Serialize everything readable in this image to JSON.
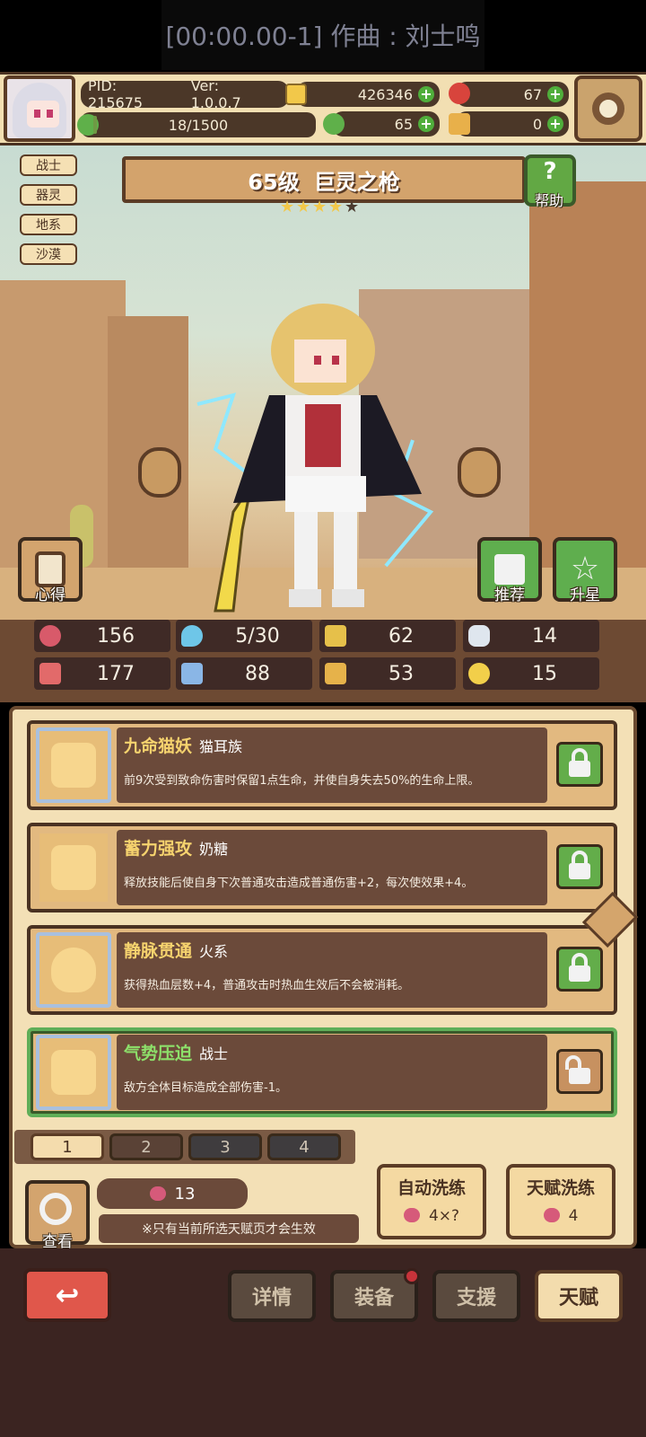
{
  "caption": "[00:00.00-1] 作曲 : 刘士鸣",
  "header": {
    "pid": "PID: 215675",
    "version": "Ver: 1.0.0.7",
    "gold": "426346",
    "ruby": "67",
    "clover": "65",
    "key": "0",
    "stamina": "18/1500",
    "stamina_fraction": 0.012
  },
  "tags": [
    "战士",
    "器灵",
    "地系",
    "沙漠"
  ],
  "hero": {
    "level": "65级",
    "name": "巨灵之枪",
    "stars_filled": 4,
    "stars_total": 5
  },
  "buttons": {
    "help": "帮助",
    "help_icon": "?",
    "insight": "心得",
    "recommend": "推荐",
    "star_up": "升星"
  },
  "stats": {
    "hp": "156",
    "mana": "5/30",
    "armor": "62",
    "speed": "14",
    "attack": "177",
    "magic": "88",
    "boots": "53",
    "crit": "15"
  },
  "talents": [
    {
      "name": "九命猫妖",
      "tag": "猫耳族",
      "desc": "前9次受到致命伤害时保留1点生命，并使自身失去50%的生命上限。",
      "state": "locked"
    },
    {
      "name": "蓄力强攻",
      "tag": "奶糖",
      "desc": "释放技能后使自身下次普通攻击造成普通伤害+2，每次使效果+4。",
      "state": "locked"
    },
    {
      "name": "静脉贯通",
      "tag": "火系",
      "desc": "获得热血层数+4，普通攻击时热血生效后不会被消耗。",
      "state": "locked"
    },
    {
      "name": "气势压迫",
      "tag": "战士",
      "desc": "敌方全体目标造成全部伤害-1。",
      "state": "unlocked"
    }
  ],
  "pages": [
    "1",
    "2",
    "3",
    "4"
  ],
  "bottom": {
    "view_label": "查看",
    "gem_count": "13",
    "note": "※只有当前所选天赋页才会生效",
    "auto_wash_title": "自动洗练",
    "auto_wash_cost": "4×?",
    "talent_wash_title": "天赋洗练",
    "talent_wash_cost": "4"
  },
  "nav": {
    "back_icon": "↩",
    "details": "详情",
    "equipment": "装备",
    "support": "支援",
    "talent": "天赋"
  },
  "colors": {
    "accent_gold": "#f6d36e",
    "lock_green": "#63ad4a",
    "back_red": "#e0574b"
  }
}
